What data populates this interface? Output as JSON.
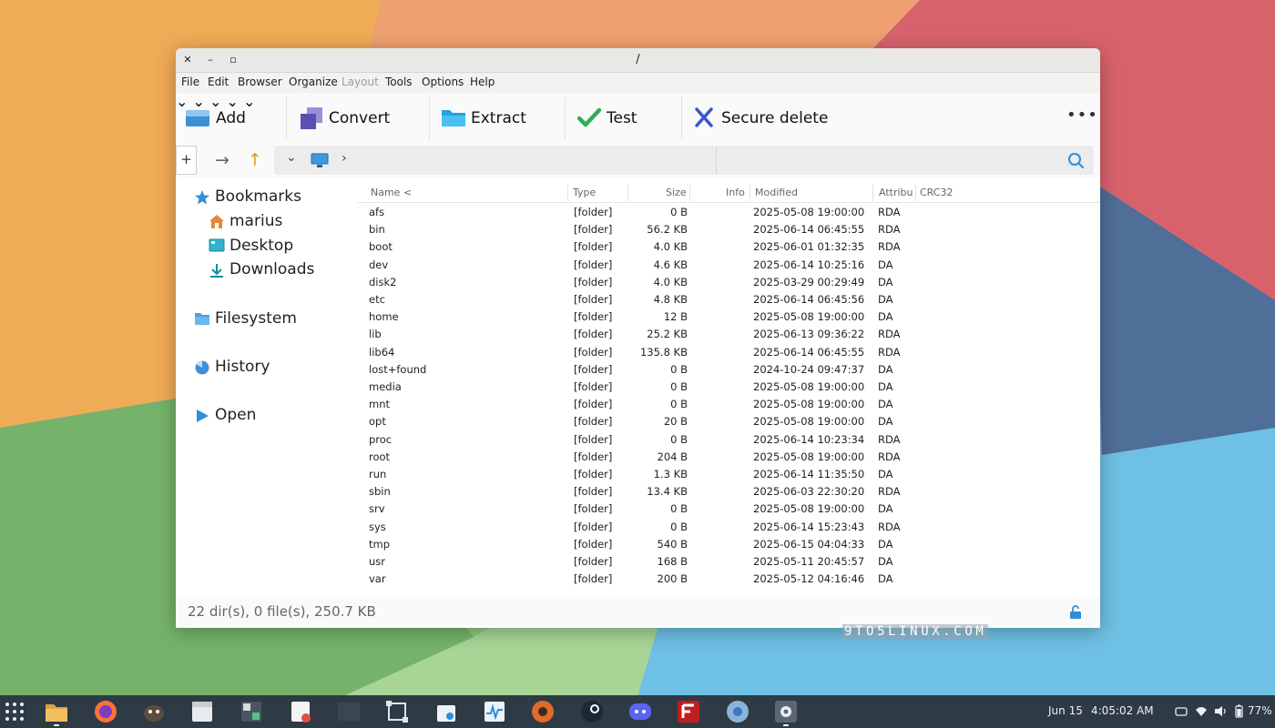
{
  "window": {
    "title": "/",
    "controls": {
      "close": "✕",
      "minimize": "–",
      "maximize": "▫"
    }
  },
  "menu": [
    "File",
    "Edit",
    "Browser",
    "Organize",
    "Layout",
    "Tools",
    "Options",
    "Help"
  ],
  "menu_disabled": [
    "Layout"
  ],
  "toolbar": {
    "add": "Add",
    "convert": "Convert",
    "extract": "Extract",
    "test": "Test",
    "secure_delete": "Secure delete",
    "more": "•••"
  },
  "nav": {
    "new_tab": "+"
  },
  "sidebar": {
    "bookmarks": "Bookmarks",
    "items": [
      "marius",
      "Desktop",
      "Downloads"
    ],
    "filesystem": "Filesystem",
    "history": "History",
    "open": "Open"
  },
  "columns": [
    "Name <",
    "Type",
    "Size",
    "Info",
    "Modified",
    "Attribu",
    "CRC32"
  ],
  "rows": [
    {
      "name": "afs",
      "type": "[folder]",
      "size": "0 B",
      "modified": "2025-05-08 19:00:00",
      "attr": "RDA"
    },
    {
      "name": "bin",
      "type": "[folder]",
      "size": "56.2 KB",
      "modified": "2025-06-14 06:45:55",
      "attr": "RDA"
    },
    {
      "name": "boot",
      "type": "[folder]",
      "size": "4.0 KB",
      "modified": "2025-06-01 01:32:35",
      "attr": "RDA"
    },
    {
      "name": "dev",
      "type": "[folder]",
      "size": "4.6 KB",
      "modified": "2025-06-14 10:25:16",
      "attr": "DA"
    },
    {
      "name": "disk2",
      "type": "[folder]",
      "size": "4.0 KB",
      "modified": "2025-03-29 00:29:49",
      "attr": "DA"
    },
    {
      "name": "etc",
      "type": "[folder]",
      "size": "4.8 KB",
      "modified": "2025-06-14 06:45:56",
      "attr": "DA"
    },
    {
      "name": "home",
      "type": "[folder]",
      "size": "12 B",
      "modified": "2025-05-08 19:00:00",
      "attr": "DA"
    },
    {
      "name": "lib",
      "type": "[folder]",
      "size": "25.2 KB",
      "modified": "2025-06-13 09:36:22",
      "attr": "RDA"
    },
    {
      "name": "lib64",
      "type": "[folder]",
      "size": "135.8 KB",
      "modified": "2025-06-14 06:45:55",
      "attr": "RDA"
    },
    {
      "name": "lost+found",
      "type": "[folder]",
      "size": "0 B",
      "modified": "2024-10-24 09:47:37",
      "attr": "DA"
    },
    {
      "name": "media",
      "type": "[folder]",
      "size": "0 B",
      "modified": "2025-05-08 19:00:00",
      "attr": "DA"
    },
    {
      "name": "mnt",
      "type": "[folder]",
      "size": "0 B",
      "modified": "2025-05-08 19:00:00",
      "attr": "DA"
    },
    {
      "name": "opt",
      "type": "[folder]",
      "size": "20 B",
      "modified": "2025-05-08 19:00:00",
      "attr": "DA"
    },
    {
      "name": "proc",
      "type": "[folder]",
      "size": "0 B",
      "modified": "2025-06-14 10:23:34",
      "attr": "RDA"
    },
    {
      "name": "root",
      "type": "[folder]",
      "size": "204 B",
      "modified": "2025-05-08 19:00:00",
      "attr": "RDA"
    },
    {
      "name": "run",
      "type": "[folder]",
      "size": "1.3 KB",
      "modified": "2025-06-14 11:35:50",
      "attr": "DA"
    },
    {
      "name": "sbin",
      "type": "[folder]",
      "size": "13.4 KB",
      "modified": "2025-06-03 22:30:20",
      "attr": "RDA"
    },
    {
      "name": "srv",
      "type": "[folder]",
      "size": "0 B",
      "modified": "2025-05-08 19:00:00",
      "attr": "DA"
    },
    {
      "name": "sys",
      "type": "[folder]",
      "size": "0 B",
      "modified": "2025-06-14 15:23:43",
      "attr": "RDA"
    },
    {
      "name": "tmp",
      "type": "[folder]",
      "size": "540 B",
      "modified": "2025-06-15 04:04:33",
      "attr": "DA"
    },
    {
      "name": "usr",
      "type": "[folder]",
      "size": "168 B",
      "modified": "2025-05-11 20:45:57",
      "attr": "DA"
    },
    {
      "name": "var",
      "type": "[folder]",
      "size": "200 B",
      "modified": "2025-05-12 04:16:46",
      "attr": "DA"
    }
  ],
  "status": "22 dir(s), 0 file(s), 250.7 KB",
  "watermark": "9TO5LINUX.COM",
  "taskbar": {
    "apps": [
      "app-grid-icon",
      "file-manager-icon",
      "firefox-icon",
      "gimp-icon",
      "calendar-icon",
      "calculator-icon",
      "text-editor-icon",
      "terminal-icon",
      "screenshot-icon",
      "software-store-icon",
      "system-monitor-icon",
      "darktable-icon",
      "steam-icon",
      "discord-icon",
      "filezilla-icon",
      "chromium-icon",
      "archiver-icon"
    ],
    "date": "Jun 15",
    "time": "4:05:02 AM",
    "battery": "77%"
  },
  "colors": {
    "accent_blue": "#2f8fd8",
    "test_green": "#2eae55",
    "delete_blue": "#3a55c9",
    "home_orange": "#e8873a",
    "taskbar": "#2e3a44"
  }
}
